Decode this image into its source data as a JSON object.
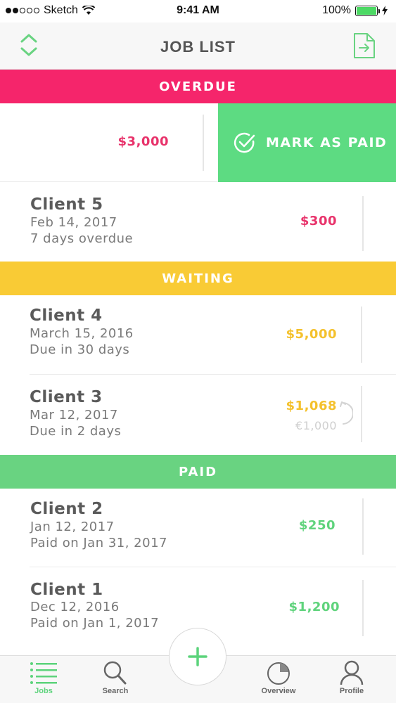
{
  "status_bar": {
    "carrier": "Sketch",
    "time": "9:41 AM",
    "battery": "100%"
  },
  "nav": {
    "title": "JOB LIST",
    "left_icon": "sort-icon",
    "right_icon": "export-icon"
  },
  "sections": {
    "overdue": "OVERDUE",
    "waiting": "WAITING",
    "paid": "PAID"
  },
  "swiped_row": {
    "amount": "$3,000",
    "action_label": "MARK AS PAID"
  },
  "jobs": [
    {
      "name": "Client 5",
      "date": "Feb 14, 2017",
      "status": "7 days overdue",
      "amount": "$300"
    },
    {
      "name": "Client 4",
      "date": "March 15, 2016",
      "status": "Due in 30 days",
      "amount": "$5,000"
    },
    {
      "name": "Client 3",
      "date": "Mar 12, 2017",
      "status": "Due in 2 days",
      "amount": "$1,068",
      "converted_amount": "€1,000"
    },
    {
      "name": "Client 2",
      "date": "Jan 12, 2017",
      "status": "Paid on Jan 31, 2017",
      "amount": "$250"
    },
    {
      "name": "Client 1",
      "date": "Dec 12, 2016",
      "status": "Paid on Jan 1, 2017",
      "amount": "$1,200"
    }
  ],
  "tabs": [
    {
      "label": "Jobs",
      "icon": "list-icon",
      "active": true
    },
    {
      "label": "Search",
      "icon": "search-icon",
      "active": false
    },
    {
      "label": "Overview",
      "icon": "pie-chart-icon",
      "active": false
    },
    {
      "label": "Profile",
      "icon": "user-icon",
      "active": false
    }
  ],
  "fab_icon": "plus-icon",
  "colors": {
    "overdue": "#f5256b",
    "waiting": "#f9cb35",
    "paid": "#69d381",
    "mark_paid": "#5ddb82"
  }
}
